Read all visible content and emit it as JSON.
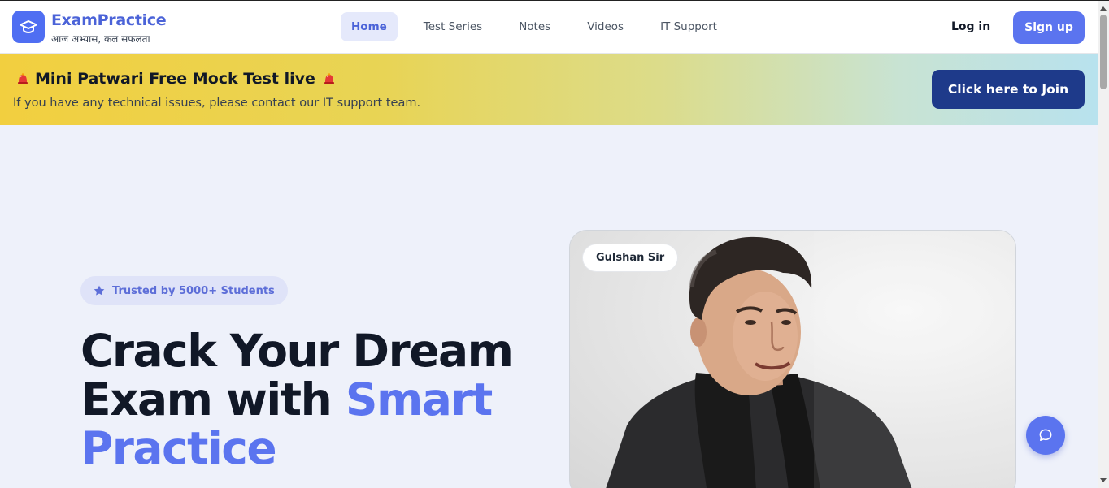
{
  "brand": {
    "name": "ExamPractice",
    "tagline": "आज अभ्यास, कल सफलता",
    "logo_icon": "graduation-cap-icon"
  },
  "nav": {
    "links": [
      {
        "label": "Home",
        "active": true
      },
      {
        "label": "Test Series",
        "active": false
      },
      {
        "label": "Notes",
        "active": false
      },
      {
        "label": "Videos",
        "active": false
      },
      {
        "label": "IT Support",
        "active": false
      }
    ],
    "login_label": "Log in",
    "signup_label": "Sign up"
  },
  "banner": {
    "title": "Mini Patwari Free Mock Test live",
    "subtitle": "If you have any technical issues, please contact our IT support team.",
    "cta_label": "Click here to Join",
    "icon": "alarm-bell-icon"
  },
  "hero": {
    "badge_text": "Trusted by 5000+ Students",
    "badge_icon": "star-icon",
    "headline_line1": "Crack Your Dream",
    "headline_line2_plain": "Exam with ",
    "headline_line2_accent": "Smart",
    "headline_line3_accent": "Practice",
    "teacher_name": "Gulshan Sir"
  },
  "chat": {
    "icon": "chat-bubble-icon"
  },
  "colors": {
    "brand": "#4b63d8",
    "accent": "#5b74ef",
    "cta_dark": "#1e3a8a",
    "banner_start": "#f2cf3f",
    "banner_end": "#b8e2ee"
  }
}
